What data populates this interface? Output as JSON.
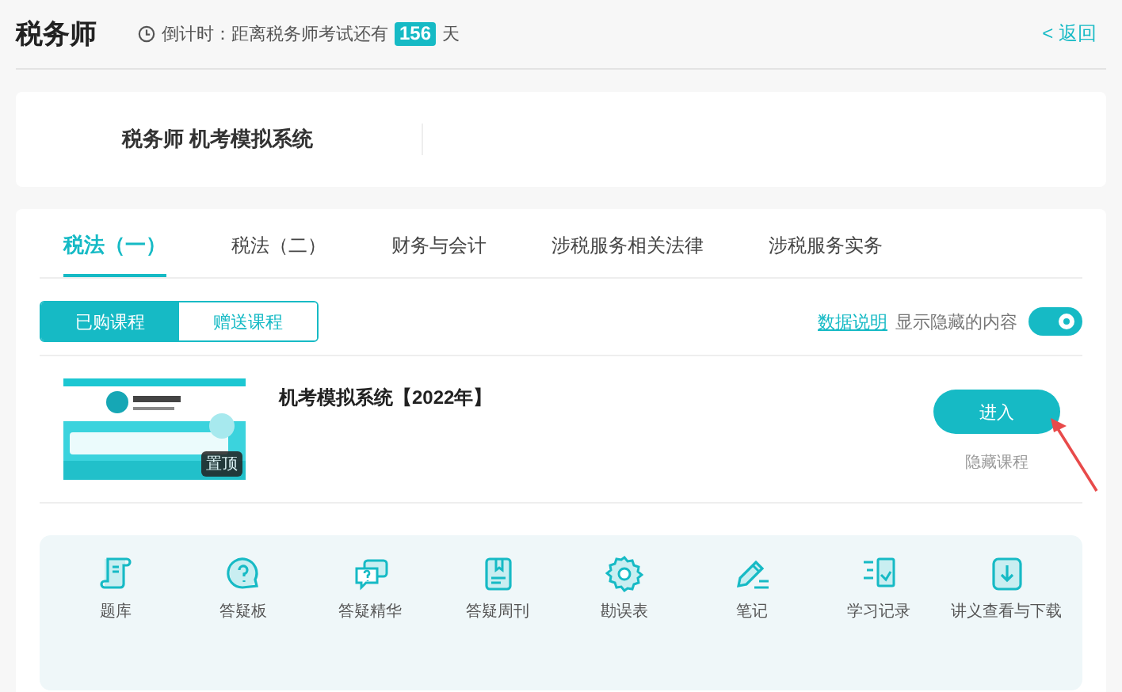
{
  "header": {
    "title": "税务师",
    "countdown_label": "倒计时：距离税务师考试还有",
    "days": "156",
    "days_unit": "天",
    "back": "< 返回"
  },
  "exam_card": {
    "title": "税务师 机考模拟系统"
  },
  "tabs": [
    {
      "label": "税法（一）",
      "selected": true
    },
    {
      "label": "税法（二）",
      "selected": false
    },
    {
      "label": "财务与会计",
      "selected": false
    },
    {
      "label": "涉税服务相关法律",
      "selected": false
    },
    {
      "label": "涉税服务实务",
      "selected": false
    }
  ],
  "segments": [
    {
      "label": "已购课程",
      "selected": true
    },
    {
      "label": "赠送课程",
      "selected": false
    }
  ],
  "data_link": "数据说明",
  "toggle": {
    "label": "显示隐藏的内容",
    "on": true
  },
  "course": {
    "pin_badge": "置顶",
    "title": "机考模拟系统【2022年】",
    "enter": "进入",
    "hide": "隐藏课程"
  },
  "tools": [
    {
      "label": "题库"
    },
    {
      "label": "答疑板"
    },
    {
      "label": "答疑精华"
    },
    {
      "label": "答疑周刊"
    },
    {
      "label": "勘误表"
    },
    {
      "label": "笔记"
    },
    {
      "label": "学习记录"
    },
    {
      "label": "讲义查看与下载"
    }
  ]
}
